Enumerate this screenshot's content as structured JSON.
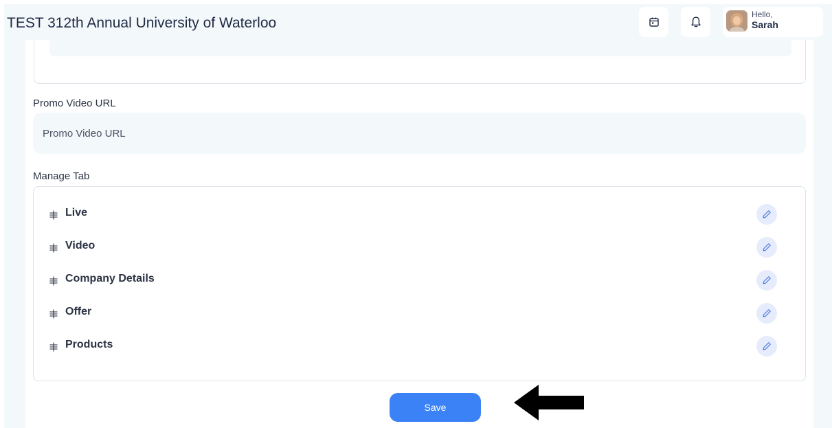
{
  "header": {
    "title": "TEST 312th Annual University of Waterloo",
    "calendar_icon": "calendar-icon",
    "bell_icon": "bell-icon",
    "user": {
      "greeting": "Hello,",
      "name": "Sarah"
    }
  },
  "form": {
    "promo_video": {
      "label": "Promo Video URL",
      "placeholder": "Promo Video URL",
      "value": ""
    },
    "manage_tab": {
      "label": "Manage Tab",
      "tabs": [
        {
          "label": "Live"
        },
        {
          "label": "Video"
        },
        {
          "label": "Company Details"
        },
        {
          "label": "Offer"
        },
        {
          "label": "Products"
        }
      ]
    },
    "save_label": "Save"
  },
  "colors": {
    "accent": "#3b82f6",
    "panel_bg": "#f3f8fb",
    "edit_bg": "#e6ecfb"
  }
}
